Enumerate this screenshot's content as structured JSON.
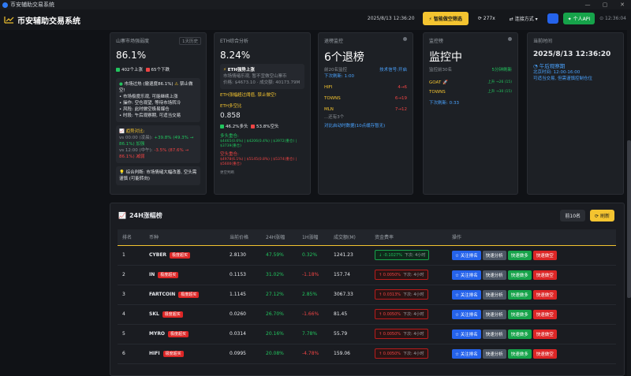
{
  "window": {
    "title": "币安辅助交易系统"
  },
  "header": {
    "brand": "币安辅助交易系统",
    "datetime": "2025/8/13 12:36:20",
    "smart_btn": "智能做空筛选",
    "count": "277x",
    "connect": "连接方式",
    "api_btn": "个人API",
    "time2": "12:36:04"
  },
  "cards": {
    "alt": {
      "title": "山寨市场强弱度",
      "tag": "1天历史",
      "pct": "86.1%",
      "up": "402个上涨",
      "down": "65个下跌",
      "alert": "市场过热 (撤退度86.1%)",
      "alert2": "禁止做空!",
      "line1": "• 市场极度乐观, 可能继续上涨",
      "line2": "• 操作: 空仓观望, 等待市场转冷",
      "line3": "• 风险: 此时做空极易爆仓",
      "line4": "• 时段: 午后观察期, 可适当交易",
      "trend_title": "趋势对比:",
      "trend1": "vs 00:00 (凌晨):",
      "trend1v": "+39.8% (49.3% → 86.1%)",
      "trend1s": "加强",
      "trend2": "vs 12:00 (中午):",
      "trend2v": "-3.5% (87.6% → 86.1%)",
      "trend2s": "减弱",
      "summary": "综合判断: 市场情绪大幅改善, 空头需谨慎 (可能转向)"
    },
    "eth": {
      "title": "ETH综合分析",
      "pct": "8.24%",
      "inner_title": "ETH强势上涨",
      "inner_sub": "市场情绪乐观, 暂不宜做空山寨币",
      "price": "价格: $4673.10",
      "vol": "成交额: 40173.79M",
      "warn": "ETH涨幅超过阈值, 禁止做空!",
      "ratio_title": "ETH多空比",
      "ratio": "0.858",
      "long": "46.2%多头",
      "short": "53.8%空头",
      "long_title": "多头重仓:",
      "long_detail": "$4465(0.6%) | $4206(0.4%) | $3972(重仓) | $3739(重仓)",
      "short_title": "空头重仓:",
      "short_detail": "$4978(6.1%) | $5145(0.8%) | $5374(重仓) | $5600(重仓)",
      "footer": "更空判断"
    },
    "retreat": {
      "title": "退榜监控",
      "count": "6个退榜",
      "sub": "前20名监控",
      "sig": "技术信号:开启",
      "next": "下次刷新: 1:00",
      "items": [
        {
          "sym": "HIFI",
          "val": "4→6"
        },
        {
          "sym": "TOWNS",
          "val": "6→19"
        },
        {
          "sym": "MLN",
          "val": "7→12"
        }
      ],
      "more": "...还有3个",
      "footer": "对比启动时数据(10点缓存暂无)"
    },
    "monitor": {
      "title": "监控榜",
      "status": "监控中",
      "sub": "监控前30名",
      "refresh": "5分钟刷新",
      "items": [
        {
          "sym": "GOAT",
          "val": "上升 →26 (15)"
        },
        {
          "sym": "TOWNS",
          "val": "上升 →30 (15)"
        }
      ],
      "next": "下次刷新: 0:33"
    },
    "time": {
      "title": "当前时间",
      "datetime": "2025/8/13 12:36:20",
      "period": "午后观察期",
      "bj": "北京时间: 12:00-16:00",
      "tip": "可适当交易, 但需谨慎控制仓位"
    }
  },
  "ranking": {
    "title": "24H涨幅榜",
    "top_btn": "前10名",
    "refresh_btn": "刷新",
    "columns": [
      "排名",
      "币种",
      "当前价格",
      "24H涨幅",
      "1H涨幅",
      "成交额(M)",
      "资金费率",
      "操作"
    ],
    "badge_text": "极度超买",
    "actions": [
      "关注排名",
      "快速分析",
      "快速做多",
      "快速做空"
    ],
    "rows": [
      {
        "rank": "1",
        "sym": "CYBER",
        "price": "2.8130",
        "ch24": "47.59%",
        "ch1": "0.32%",
        "ch1c": "g",
        "vol": "1241.23",
        "fund": "-0.1027%",
        "fsub": "下次: 4小时",
        "neg": true
      },
      {
        "rank": "2",
        "sym": "IN",
        "price": "0.1153",
        "ch24": "31.02%",
        "ch1": "-1.18%",
        "ch1c": "r",
        "vol": "157.74",
        "fund": "0.0050%",
        "fsub": "下次: 4小时",
        "neg": false
      },
      {
        "rank": "3",
        "sym": "FARTCOIN",
        "price": "1.1145",
        "ch24": "27.12%",
        "ch1": "2.85%",
        "ch1c": "g",
        "vol": "3067.33",
        "fund": "0.0313%",
        "fsub": "下次: 4小时",
        "neg": false
      },
      {
        "rank": "4",
        "sym": "SKL",
        "price": "0.0260",
        "ch24": "26.70%",
        "ch1": "-1.66%",
        "ch1c": "r",
        "vol": "81.45",
        "fund": "0.0050%",
        "fsub": "下次: 4小时",
        "neg": false
      },
      {
        "rank": "5",
        "sym": "MYRO",
        "price": "0.0314",
        "ch24": "20.16%",
        "ch1": "7.78%",
        "ch1c": "g",
        "vol": "55.79",
        "fund": "0.0050%",
        "fsub": "下次: 4小时",
        "neg": false
      },
      {
        "rank": "6",
        "sym": "HIFI",
        "price": "0.0995",
        "ch24": "20.08%",
        "ch1": "-4.78%",
        "ch1c": "r",
        "vol": "159.06",
        "fund": "0.0050%",
        "fsub": "下次: 4小时",
        "neg": false
      }
    ]
  }
}
